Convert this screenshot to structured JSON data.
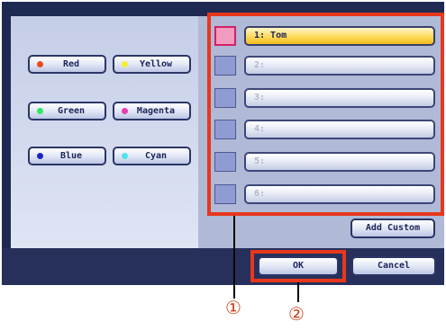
{
  "colors": {
    "screen_bg": "#1f2a52",
    "highlight": "#e8371c",
    "selected_slot": "#ffd95a",
    "selected_swatch": "#f19cbf",
    "callout": "#c8431b"
  },
  "color_buttons": [
    {
      "label": "Red",
      "dot": "#ef4a1b"
    },
    {
      "label": "Yellow",
      "dot": "#f5ee36"
    },
    {
      "label": "Green",
      "dot": "#2fe85e"
    },
    {
      "label": "Magenta",
      "dot": "#e93fb2"
    },
    {
      "label": "Blue",
      "dot": "#1a25c8"
    },
    {
      "label": "Cyan",
      "dot": "#4fe3ee"
    }
  ],
  "custom_slots": [
    {
      "label": "1: Tom",
      "selected": true
    },
    {
      "label": "2:",
      "selected": false
    },
    {
      "label": "3:",
      "selected": false
    },
    {
      "label": "4:",
      "selected": false
    },
    {
      "label": "5:",
      "selected": false
    },
    {
      "label": "6:",
      "selected": false
    }
  ],
  "buttons": {
    "add_custom": "Add Custom",
    "ok": "OK",
    "cancel": "Cancel"
  },
  "callouts": {
    "first": "①",
    "second": "②"
  }
}
